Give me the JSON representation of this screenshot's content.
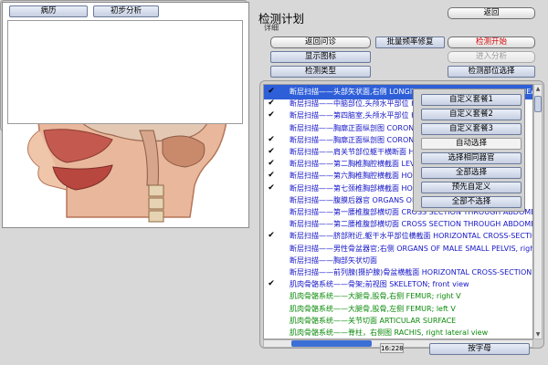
{
  "header": {
    "title": "检测计划",
    "subtitle": "详细"
  },
  "buttons": {
    "back": "返回",
    "return_consult": "返回问诊",
    "batch_repair": "批量频率修复",
    "start_detect": "检测开始",
    "show_icons": "显示图标",
    "enter_analysis": "进入分析",
    "detect_type": "检测类型",
    "detect_site_select": "检测部位选择",
    "sort_alpha": "按字母"
  },
  "dropdown": {
    "items": [
      "自定义套餐1",
      "自定义套餐2",
      "自定义套餐3",
      "自动选择",
      "选择相同器官",
      "全部选择",
      "预先自定义",
      "全部不选择"
    ]
  },
  "bottom_left": {
    "tab_history": "病历",
    "tab_analysis": "初步分析"
  },
  "status": {
    "timer": "16:228"
  },
  "list": {
    "rows": [
      {
        "text": "断层扫描——头部矢状面,右侧 LONGITUDINAL CROSS SECTION OF HEAD, right",
        "checked": true,
        "color": "blue",
        "selected": true
      },
      {
        "text": "断层扫描——中脑部位,头颅水平部位 HORIZONTAL CROSS-SECTION",
        "checked": true,
        "color": "blue"
      },
      {
        "text": "断层扫描——第四脑室,头颅水平部位 HORIZONTAL CROSS-SECTION",
        "checked": true,
        "color": "blue"
      },
      {
        "text": "断层扫描——胸廓正面纵剖图 CORONAL SECTION OF THORAX",
        "checked": false,
        "color": "blue"
      },
      {
        "text": "断层扫描——胸廓正面纵剖图 CORONAL SECTION OF THORAX",
        "checked": true,
        "color": "blue"
      },
      {
        "text": "断层扫描——肩关节部位躯干横断面 HORIZONTAL CROSS-SECTION",
        "checked": true,
        "color": "blue"
      },
      {
        "text": "断层扫描——第二胸椎胸腔横截面 LEVEL OF SECOND THORACIC",
        "checked": true,
        "color": "blue"
      },
      {
        "text": "断层扫描——第六胸椎胸腔横截面 HORIZONTAL CROSS-SECTION",
        "checked": true,
        "color": "blue"
      },
      {
        "text": "断层扫描——第七颈椎胸部横截面 HORIZONTAL CROSS-SECTION",
        "checked": true,
        "color": "blue"
      },
      {
        "text": "断层扫描——腹膜后器官 ORGANS OF RETROPERITONEAL SPACE",
        "checked": false,
        "color": "blue"
      },
      {
        "text": "断层扫描——第一腰椎腹部横切面 CROSS SECTION THROUGH ABDOMEN",
        "checked": false,
        "color": "blue"
      },
      {
        "text": "断层扫描——第二腰椎腹部横切面 CROSS SECTION THROUGH ABDOMEN at L2",
        "checked": false,
        "color": "blue"
      },
      {
        "text": "断层扫描——脐部附近,躯干水平部位横截面 HORIZONTAL CROSS-SECTION",
        "checked": true,
        "color": "blue"
      },
      {
        "text": "断层扫描——男性骨盆器官;右侧 ORGANS OF MALE SMALL PELVIS, right side",
        "checked": false,
        "color": "blue"
      },
      {
        "text": "断层扫描——胸部矢状切面",
        "checked": false,
        "color": "blue"
      },
      {
        "text": "断层扫描——前列腺(摄护腺)骨盆横截面 HORIZONTAL CROSS-SECTION OF PELVIS",
        "checked": false,
        "color": "blue"
      },
      {
        "text": "肌肉骨骼系统——骨架;前视图 SKELETON; front view",
        "checked": true,
        "color": "blue"
      },
      {
        "text": "肌肉骨骼系统——大腿骨,股骨,右侧 FEMUR;  right  V",
        "checked": false,
        "color": "green"
      },
      {
        "text": "肌肉骨骼系统——大腿骨,股骨,左侧 FEMUR;  left  V",
        "checked": false,
        "color": "green"
      },
      {
        "text": "肌肉骨骼系统——关节切面 ARTICULAR SURFACE",
        "checked": false,
        "color": "green"
      },
      {
        "text": "肌肉骨骼系统——脊柱，右侧图 RACHIS, right lateral view",
        "checked": false,
        "color": "green"
      }
    ]
  }
}
